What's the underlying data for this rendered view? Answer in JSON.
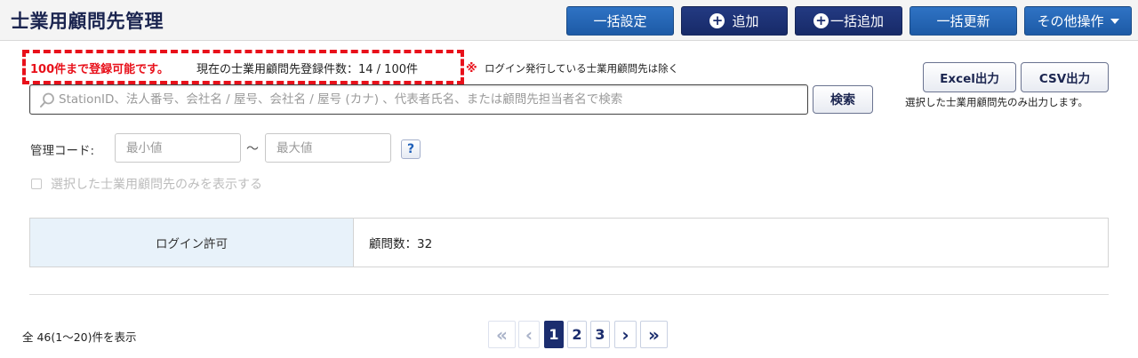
{
  "header": {
    "title": "士業用顧問先管理",
    "buttons": {
      "bulk_settings": "一括設定",
      "add": "追加",
      "bulk_add": "一括追加",
      "bulk_update": "一括更新",
      "other_ops": "その他操作"
    }
  },
  "notice": {
    "limit": "100件まで登録可能です。",
    "current_count": "現在の士業用顧問先登録件数：14 / 100件",
    "note_mark": "※",
    "note": "ログイン発行している士業用顧問先は除く"
  },
  "search": {
    "placeholder": "StationID、法人番号、会社名 / 屋号、会社名 / 屋号 (カナ) 、代表者氏名、または顧問先担当者名で検索",
    "button": "検索"
  },
  "export": {
    "excel": "Excel出力",
    "csv": "CSV出力",
    "note": "選択した士業用顧問先のみ出力します。"
  },
  "management_code": {
    "label": "管理コード:",
    "min_placeholder": "最小値",
    "max_placeholder": "最大値",
    "separator": "～",
    "help": "?"
  },
  "filter": {
    "only_selected": "選択した士業用顧問先のみを表示する"
  },
  "status_table": {
    "label": "ログイン許可",
    "value": "顧問数：32"
  },
  "results": {
    "summary": "全 46(1～20)件を表示"
  },
  "pagination": {
    "first": "«",
    "prev": "‹",
    "pages": [
      "1",
      "2",
      "3"
    ],
    "current": "1",
    "next": "›",
    "last": "»"
  }
}
